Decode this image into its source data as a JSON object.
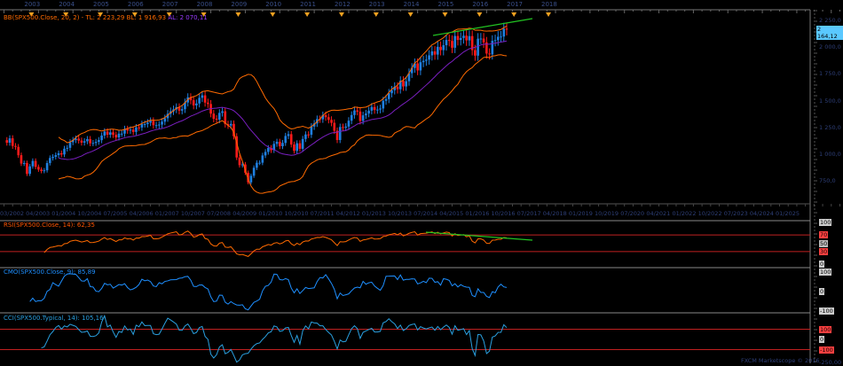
{
  "years": [
    "2003",
    "2004",
    "2005",
    "2006",
    "2007",
    "2008",
    "2009",
    "2010",
    "2011",
    "2012",
    "2013",
    "2014",
    "2015",
    "2016",
    "2017",
    "2018"
  ],
  "date_labels": [
    "03/2002",
    "04/2003",
    "01/2004",
    "10/2004",
    "07/2005",
    "04/2006",
    "01/2007",
    "10/2007",
    "07/2008",
    "04/2009",
    "01/2010",
    "10/2010",
    "07/2011",
    "04/2012",
    "01/2013",
    "10/2013",
    "07/2014",
    "04/2015",
    "01/2016",
    "10/2016",
    "07/2017",
    "04/2018",
    "01/2019",
    "10/2019",
    "07/2020",
    "04/2021",
    "01/2022",
    "10/2022",
    "07/2023",
    "04/2024",
    "01/2025"
  ],
  "legends": {
    "bb": "BB(SPX500.Close, 20, 2) -",
    "bb_tl": "TL: 2 223,29",
    "bb_bl": "BL: 1 916,93",
    "bb_al": "AL: 2 070,11",
    "rsi": "RSI(SPX500.Close, 14): 62,35",
    "cmo": "CMO(SPX500.Close, 9): 85,89",
    "cci": "CCI(SPX500.Typical, 14): 105,16"
  },
  "price_axis": [
    "2 250,0",
    "2 000,0",
    "1 750,0",
    "1 500,0",
    "1 250,0",
    "1 000,0",
    "750,0"
  ],
  "current_price": "2 164,12",
  "rsi_axis": [
    "100",
    "70",
    "50",
    "30",
    "0"
  ],
  "cmo_axis": [
    "100",
    "0",
    "-100"
  ],
  "cci_axis": [
    "100",
    "0",
    "-100"
  ],
  "bottom_cut_label": "-250,00",
  "copyright": "FXCM Marketscope © 2016",
  "colors": {
    "bull": "#1e7fe0",
    "bear": "#ff1a1a",
    "band": "#ff6a00",
    "mid": "#7a1fc0",
    "rsi": "#ff6a00",
    "cmo": "#1e8fff",
    "cci": "#2aa0e0",
    "trend": "#22c422"
  },
  "chart_data": {
    "type": "candlestick",
    "symbol": "SPX500",
    "interval": "monthly",
    "start": "01/2002",
    "closes": [
      1130,
      1106,
      1147,
      1076,
      1067,
      989,
      911,
      916,
      815,
      885,
      936,
      880,
      855,
      841,
      848,
      916,
      963,
      974,
      990,
      1008,
      996,
      1050,
      1058,
      1111,
      1131,
      1144,
      1126,
      1107,
      1120,
      1140,
      1101,
      1104,
      1114,
      1130,
      1173,
      1211,
      1181,
      1203,
      1180,
      1156,
      1191,
      1191,
      1234,
      1220,
      1228,
      1207,
      1249,
      1248,
      1280,
      1280,
      1294,
      1310,
      1270,
      1270,
      1276,
      1303,
      1335,
      1377,
      1400,
      1418,
      1438,
      1406,
      1420,
      1482,
      1530,
      1503,
      1455,
      1473,
      1526,
      1549,
      1481,
      1468,
      1378,
      1330,
      1322,
      1385,
      1400,
      1280,
      1267,
      1282,
      1166,
      968,
      896,
      903,
      825,
      735,
      797,
      872,
      919,
      919,
      987,
      1020,
      1057,
      1036,
      1095,
      1115,
      1073,
      1104,
      1169,
      1186,
      1089,
      1030,
      1101,
      1049,
      1141,
      1183,
      1180,
      1257,
      1286,
      1327,
      1325,
      1363,
      1345,
      1320,
      1292,
      1218,
      1131,
      1253,
      1246,
      1257,
      1312,
      1365,
      1408,
      1397,
      1310,
      1362,
      1379,
      1406,
      1440,
      1412,
      1416,
      1426,
      1498,
      1514,
      1569,
      1597,
      1630,
      1606,
      1685,
      1632,
      1681,
      1756,
      1805,
      1848,
      1782,
      1859,
      1872,
      1883,
      1923,
      1960,
      1930,
      2003,
      1972,
      2018,
      2067,
      2058,
      1994,
      2104,
      2067,
      2085,
      2107,
      2063,
      2103,
      1972,
      1920,
      2079,
      2080,
      2044,
      1940,
      1932,
      2059,
      2065,
      2097,
      2099,
      2173,
      2164
    ],
    "ylim": [
      650,
      2300
    ],
    "indicators": [
      "BB(20,2)",
      "RSI(14)",
      "CMO(9)",
      "CCI(14)"
    ]
  }
}
